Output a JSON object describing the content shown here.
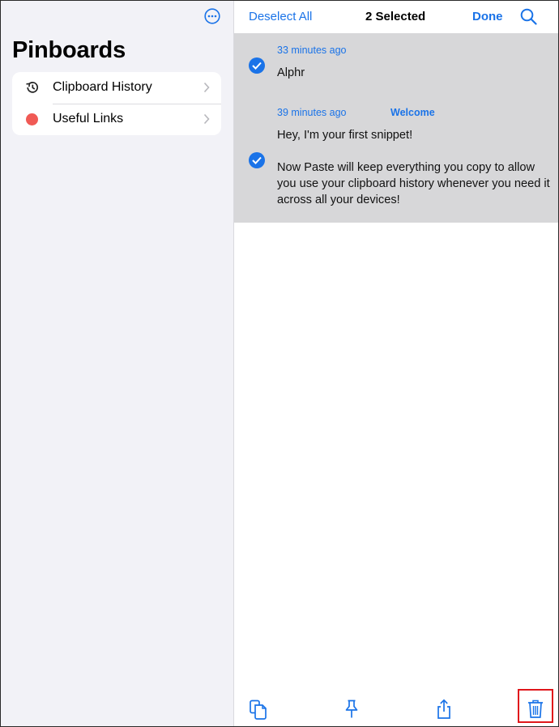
{
  "colors": {
    "accent": "#1a73e8",
    "selection_bg": "#d7d7d9",
    "sidebar_bg": "#f2f2f7",
    "red_dot": "#f05a55",
    "highlight": "#e0161b"
  },
  "sidebar": {
    "title": "Pinboards",
    "more_icon": "ellipsis-circle-icon",
    "items": [
      {
        "label": "Clipboard History",
        "icon": "history-icon"
      },
      {
        "label": "Useful Links",
        "icon": "red-dot-icon"
      }
    ]
  },
  "header": {
    "deselect_all": "Deselect All",
    "selected_count": "2 Selected",
    "done": "Done",
    "search_icon": "search-icon"
  },
  "clips": [
    {
      "time": "33 minutes ago",
      "text": "Alphr",
      "selected": true
    },
    {
      "time": "39 minutes ago",
      "tag": "Welcome",
      "text": "Hey, I'm your first snippet!\n\nNow Paste will keep everything you copy to allow you use your clipboard history whenever you need it across all your devices!",
      "selected": true
    }
  ],
  "toolbar": {
    "icons": [
      "copy-icon",
      "pin-icon",
      "share-icon",
      "trash-icon"
    ]
  }
}
